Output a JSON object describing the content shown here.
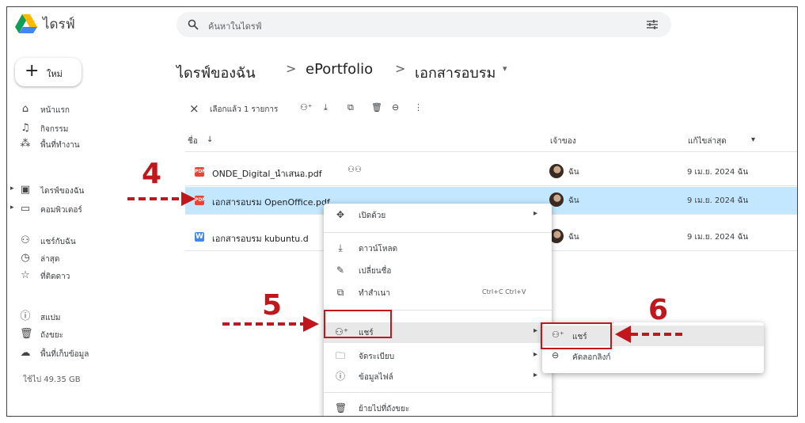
{
  "app": {
    "name": "ไดรฟ์"
  },
  "search": {
    "placeholder": "ค้นหาในไดรฟ์"
  },
  "sidebar": {
    "new_label": "ใหม่",
    "items": [
      {
        "label": "หน้าแรก",
        "icon": "home-icon"
      },
      {
        "label": "กิจกรรม",
        "icon": "bell-icon"
      },
      {
        "label": "พื้นที่ทำงาน",
        "icon": "workspaces-icon"
      },
      {
        "label": "ไดรฟ์ของฉัน",
        "icon": "my-drive-icon"
      },
      {
        "label": "คอมพิวเตอร์",
        "icon": "computer-icon"
      },
      {
        "label": "แชร์กับฉัน",
        "icon": "shared-icon"
      },
      {
        "label": "ล่าสุด",
        "icon": "clock-icon"
      },
      {
        "label": "ที่ติดดาว",
        "icon": "star-icon"
      },
      {
        "label": "สแปม",
        "icon": "spam-icon"
      },
      {
        "label": "ถังขยะ",
        "icon": "trash-icon"
      },
      {
        "label": "พื้นที่เก็บข้อมูล",
        "icon": "cloud-icon"
      }
    ],
    "storage_text": "ใช้ไป 49.35 GB"
  },
  "breadcrumb": {
    "root": "ไดรฟ์ของฉัน",
    "mid": "ePortfolio",
    "current": "เอกสารอบรม",
    "sep": ">"
  },
  "selection_bar": {
    "text": "เลือกแล้ว 1 รายการ"
  },
  "columns": {
    "name": "ชื่อ",
    "owner": "เจ้าของ",
    "modified": "แก้ไขล่าสุด"
  },
  "files": [
    {
      "name": "ONDE_Digital_นำเสนอ.pdf",
      "type": "pdf",
      "owner": "ฉัน",
      "modified": "9 เม.ย. 2024 ฉัน"
    },
    {
      "name": "เอกสารอบรม OpenOffice.pdf",
      "type": "pdf",
      "owner": "ฉัน",
      "modified": "9 เม.ย. 2024 ฉัน"
    },
    {
      "name": "เอกสารอบรม kubuntu.d",
      "type": "doc",
      "owner": "ฉัน",
      "modified": "9 เม.ย. 2024 ฉัน"
    }
  ],
  "context_menu": {
    "open_with": "เปิดด้วย",
    "download": "ดาวน์โหลด",
    "rename": "เปลี่ยนชื่อ",
    "copy": "ทำสำเนา",
    "copy_shortcut": "Ctrl+C Ctrl+V",
    "share": "แชร์",
    "organize": "จัดระเบียบ",
    "file_info": "ข้อมูลไฟล์",
    "move_trash": "ย้ายไปที่ถังขยะ"
  },
  "submenu": {
    "share": "แชร์",
    "copy_link": "คัดลอกลิงก์"
  },
  "annotations": {
    "step4": "4",
    "step5": "5",
    "step6": "6"
  },
  "colors": {
    "accent_red": "#c0161c",
    "selected_row": "#c2e7ff"
  }
}
